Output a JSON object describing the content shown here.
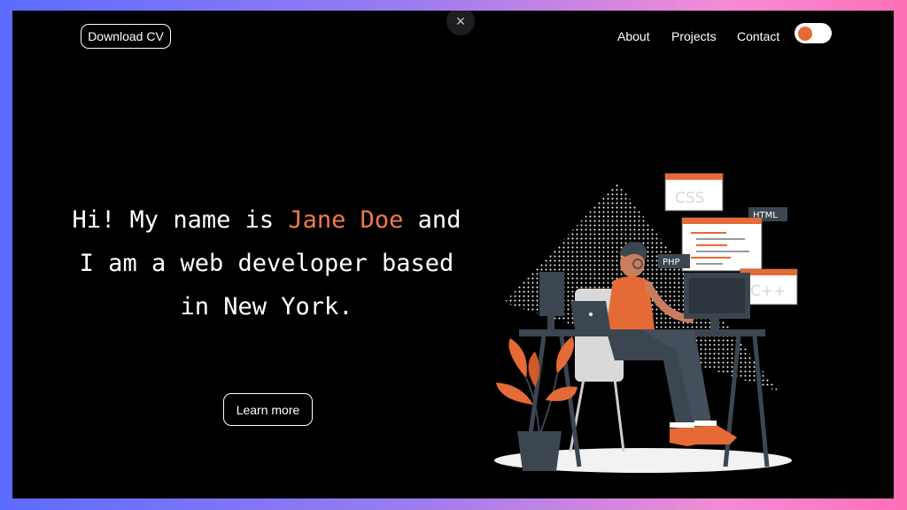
{
  "header": {
    "download_cv_label": "Download CV",
    "nav": [
      "About",
      "Projects",
      "Contact"
    ],
    "close_symbol": "×",
    "theme_toggle": {
      "state": "on",
      "knob_color": "#e56a36"
    }
  },
  "hero": {
    "headline_before": "Hi! My name is ",
    "name": "Jane Doe",
    "headline_after": " and I am a web developer based in New York.",
    "learn_more_label": "Learn more"
  },
  "illustration": {
    "cards": [
      "CSS",
      "HTML",
      "PHP",
      "C++"
    ]
  },
  "colors": {
    "accent": "#f07a4a",
    "background": "#000000",
    "border_gradient": [
      "#5b6cff",
      "#ff6fb8"
    ]
  }
}
